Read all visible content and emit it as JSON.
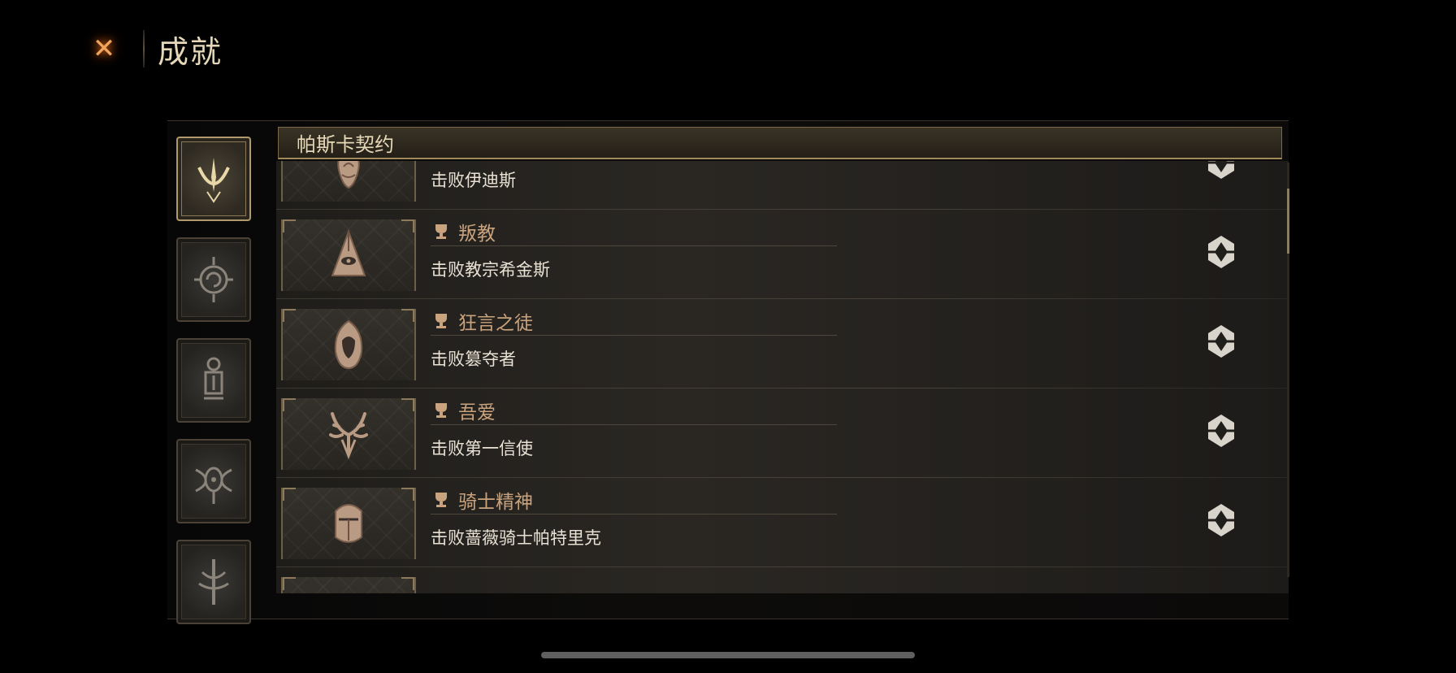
{
  "header": {
    "title": "成就",
    "close_icon": "close-x-icon"
  },
  "sidebar": {
    "tabs": [
      {
        "icon": "pascal-crest-icon",
        "active": true
      },
      {
        "icon": "sun-spiral-icon",
        "active": false
      },
      {
        "icon": "lantern-icon",
        "active": false
      },
      {
        "icon": "eye-crest-icon",
        "active": false
      },
      {
        "icon": "sword-crest-icon",
        "active": false
      }
    ]
  },
  "category": {
    "title": "帕斯卡契约"
  },
  "achievements": [
    {
      "name": "",
      "description": "击败伊迪斯",
      "icon": "flame-skull-icon",
      "completed": true
    },
    {
      "name": "叛教",
      "description": "击败教宗希金斯",
      "icon": "mitre-eye-icon",
      "completed": true
    },
    {
      "name": "狂言之徒",
      "description": "击败篡夺者",
      "icon": "hooded-figure-icon",
      "completed": true
    },
    {
      "name": "吾爱",
      "description": "击败第一信使",
      "icon": "antlers-icon",
      "completed": true
    },
    {
      "name": "骑士精神",
      "description": "击败蔷薇骑士帕特里克",
      "icon": "helmet-icon",
      "completed": true
    }
  ],
  "colors": {
    "accent": "#c9a37d",
    "frame_gold": "#a08a5c",
    "text": "#e8e1d4"
  }
}
